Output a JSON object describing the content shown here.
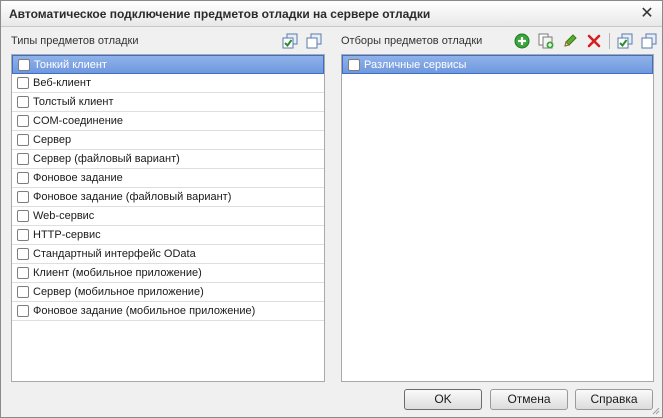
{
  "window": {
    "title": "Автоматическое подключение предметов отладки на сервере отладки",
    "close_symbol": "✕"
  },
  "left_panel": {
    "label": "Типы предметов отладки",
    "toolbar_icons": [
      "check-all-icon",
      "uncheck-all-icon"
    ],
    "items": [
      {
        "label": "Тонкий клиент",
        "checked": false,
        "selected": true
      },
      {
        "label": "Веб-клиент",
        "checked": false,
        "selected": false
      },
      {
        "label": "Толстый клиент",
        "checked": false,
        "selected": false
      },
      {
        "label": "COM-соединение",
        "checked": false,
        "selected": false
      },
      {
        "label": "Сервер",
        "checked": false,
        "selected": false
      },
      {
        "label": "Сервер (файловый вариант)",
        "checked": false,
        "selected": false
      },
      {
        "label": "Фоновое задание",
        "checked": false,
        "selected": false
      },
      {
        "label": "Фоновое задание (файловый вариант)",
        "checked": false,
        "selected": false
      },
      {
        "label": "Web-сервис",
        "checked": false,
        "selected": false
      },
      {
        "label": "HTTP-сервис",
        "checked": false,
        "selected": false
      },
      {
        "label": "Стандартный интерфейс OData",
        "checked": false,
        "selected": false
      },
      {
        "label": "Клиент (мобильное приложение)",
        "checked": false,
        "selected": false
      },
      {
        "label": "Сервер (мобильное приложение)",
        "checked": false,
        "selected": false
      },
      {
        "label": "Фоновое задание (мобильное приложение)",
        "checked": false,
        "selected": false
      }
    ]
  },
  "right_panel": {
    "label": "Отборы предметов отладки",
    "toolbar_icons": [
      "add-icon",
      "copy-icon",
      "edit-icon",
      "delete-icon",
      "check-all-icon",
      "uncheck-all-icon"
    ],
    "items": [
      {
        "label": "Различные сервисы",
        "checked": false,
        "selected": true
      }
    ]
  },
  "buttons": {
    "ok": "OK",
    "cancel": "Отмена",
    "help": "Справка"
  },
  "colors": {
    "selection": "#7aa1e2",
    "add_green": "#3aa53a",
    "delete_red": "#d42020",
    "edit_green": "#5cae2e"
  }
}
